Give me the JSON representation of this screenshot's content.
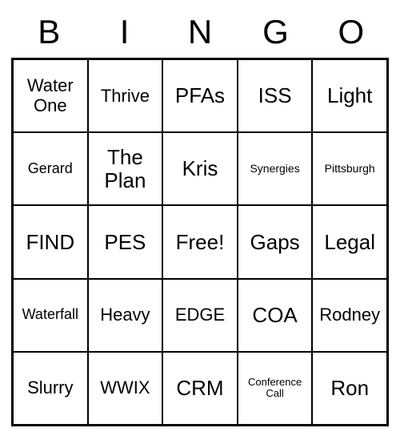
{
  "header": [
    "B",
    "I",
    "N",
    "G",
    "O"
  ],
  "cells": [
    {
      "text": "Water One",
      "size": "fs-med"
    },
    {
      "text": "Thrive",
      "size": "fs-med"
    },
    {
      "text": "PFAs",
      "size": "fs-large"
    },
    {
      "text": "ISS",
      "size": "fs-large"
    },
    {
      "text": "Light",
      "size": "fs-large"
    },
    {
      "text": "Gerard",
      "size": "fs-small"
    },
    {
      "text": "The Plan",
      "size": "fs-large"
    },
    {
      "text": "Kris",
      "size": "fs-large"
    },
    {
      "text": "Synergies",
      "size": "fs-xs"
    },
    {
      "text": "Pittsburgh",
      "size": "fs-xs"
    },
    {
      "text": "FIND",
      "size": "fs-large"
    },
    {
      "text": "PES",
      "size": "fs-large"
    },
    {
      "text": "Free!",
      "size": "fs-large"
    },
    {
      "text": "Gaps",
      "size": "fs-large"
    },
    {
      "text": "Legal",
      "size": "fs-large"
    },
    {
      "text": "Waterfall",
      "size": "fs-small"
    },
    {
      "text": "Heavy",
      "size": "fs-med"
    },
    {
      "text": "EDGE",
      "size": "fs-med"
    },
    {
      "text": "COA",
      "size": "fs-large"
    },
    {
      "text": "Rodney",
      "size": "fs-med"
    },
    {
      "text": "Slurry",
      "size": "fs-med"
    },
    {
      "text": "WWIX",
      "size": "fs-med"
    },
    {
      "text": "CRM",
      "size": "fs-large"
    },
    {
      "text": "Conference Call",
      "size": "fs-xxs"
    },
    {
      "text": "Ron",
      "size": "fs-large"
    }
  ]
}
